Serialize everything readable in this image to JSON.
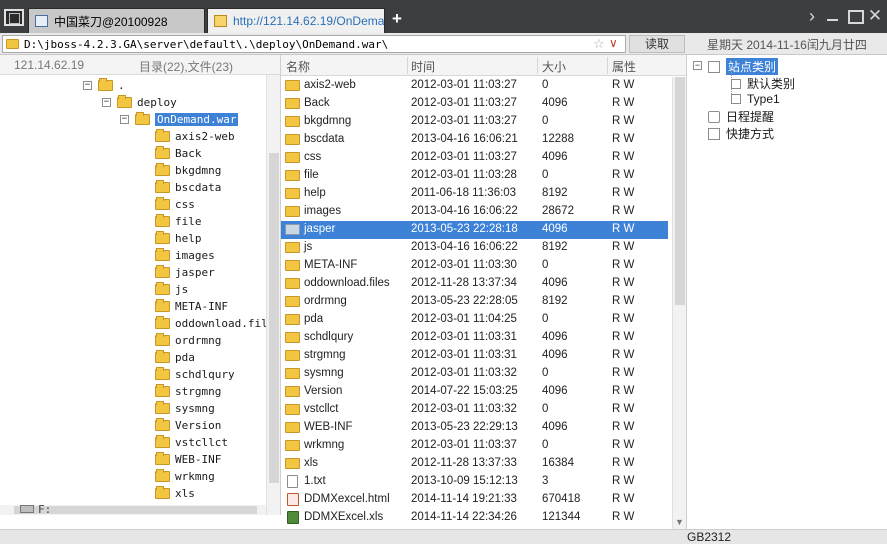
{
  "tabs": [
    {
      "label": "中国菜刀@20100928",
      "active": false
    },
    {
      "label": "http://121.14.62.19/OnDema...",
      "active": true
    }
  ],
  "new_tab_label": "+",
  "address": {
    "path": "D:\\jboss-4.2.3.GA\\server\\default\\.\\deploy\\OnDemand.war\\",
    "star_icon": "star-icon",
    "read_button": "读取",
    "date": "星期天 2014-11-16闰九月廿四"
  },
  "tree": {
    "server_ip": "121.14.62.19",
    "counts": "目录(22),文件(23)",
    "root": ".",
    "deploy": "deploy",
    "selected": "OnDemand.war",
    "children": [
      "axis2-web",
      "Back",
      "bkgdmng",
      "bscdata",
      "css",
      "file",
      "help",
      "images",
      "jasper",
      "js",
      "META-INF",
      "oddownload.file",
      "ordrmng",
      "pda",
      "schdlqury",
      "strgmng",
      "sysmng",
      "Version",
      "vstcllct",
      "WEB-INF",
      "wrkmng",
      "xls"
    ],
    "drive": "F:"
  },
  "list": {
    "headers": {
      "name": "名称",
      "time": "时间",
      "size": "大小",
      "attr": "属性"
    },
    "rows": [
      {
        "name": "axis2-web",
        "time": "2012-03-01 11:03:27",
        "size": "0",
        "attr": "R W",
        "type": "folder"
      },
      {
        "name": "Back",
        "time": "2012-03-01 11:03:27",
        "size": "4096",
        "attr": "R W",
        "type": "folder"
      },
      {
        "name": "bkgdmng",
        "time": "2012-03-01 11:03:27",
        "size": "0",
        "attr": "R W",
        "type": "folder"
      },
      {
        "name": "bscdata",
        "time": "2013-04-16 16:06:21",
        "size": "12288",
        "attr": "R W",
        "type": "folder"
      },
      {
        "name": "css",
        "time": "2012-03-01 11:03:27",
        "size": "4096",
        "attr": "R W",
        "type": "folder"
      },
      {
        "name": "file",
        "time": "2012-03-01 11:03:28",
        "size": "0",
        "attr": "R W",
        "type": "folder"
      },
      {
        "name": "help",
        "time": "2011-06-18 11:36:03",
        "size": "8192",
        "attr": "R W",
        "type": "folder"
      },
      {
        "name": "images",
        "time": "2013-04-16 16:06:22",
        "size": "28672",
        "attr": "R W",
        "type": "folder"
      },
      {
        "name": "jasper",
        "time": "2013-05-23 22:28:18",
        "size": "4096",
        "attr": "R W",
        "type": "folder",
        "selected": true
      },
      {
        "name": "js",
        "time": "2013-04-16 16:06:22",
        "size": "8192",
        "attr": "R W",
        "type": "folder"
      },
      {
        "name": "META-INF",
        "time": "2012-03-01 11:03:30",
        "size": "0",
        "attr": "R W",
        "type": "folder"
      },
      {
        "name": "oddownload.files",
        "time": "2012-11-28 13:37:34",
        "size": "4096",
        "attr": "R W",
        "type": "folder"
      },
      {
        "name": "ordrmng",
        "time": "2013-05-23 22:28:05",
        "size": "8192",
        "attr": "R W",
        "type": "folder"
      },
      {
        "name": "pda",
        "time": "2012-03-01 11:04:25",
        "size": "0",
        "attr": "R W",
        "type": "folder"
      },
      {
        "name": "schdlqury",
        "time": "2012-03-01 11:03:31",
        "size": "4096",
        "attr": "R W",
        "type": "folder"
      },
      {
        "name": "strgmng",
        "time": "2012-03-01 11:03:31",
        "size": "4096",
        "attr": "R W",
        "type": "folder"
      },
      {
        "name": "sysmng",
        "time": "2012-03-01 11:03:32",
        "size": "0",
        "attr": "R W",
        "type": "folder"
      },
      {
        "name": "Version",
        "time": "2014-07-22 15:03:25",
        "size": "4096",
        "attr": "R W",
        "type": "folder"
      },
      {
        "name": "vstcllct",
        "time": "2012-03-01 11:03:32",
        "size": "0",
        "attr": "R W",
        "type": "folder"
      },
      {
        "name": "WEB-INF",
        "time": "2013-05-23 22:29:13",
        "size": "4096",
        "attr": "R W",
        "type": "folder"
      },
      {
        "name": "wrkmng",
        "time": "2012-03-01 11:03:37",
        "size": "0",
        "attr": "R W",
        "type": "folder"
      },
      {
        "name": "xls",
        "time": "2012-11-28 13:37:33",
        "size": "16384",
        "attr": "R W",
        "type": "folder"
      },
      {
        "name": "1.txt",
        "time": "2013-10-09 15:12:13",
        "size": "3",
        "attr": "R W",
        "type": "txt"
      },
      {
        "name": "DDMXexcel.html",
        "time": "2014-11-14 19:21:33",
        "size": "670418",
        "attr": "R W",
        "type": "html"
      },
      {
        "name": "DDMXExcel.xls",
        "time": "2014-11-14 22:34:26",
        "size": "121344",
        "attr": "R W",
        "type": "xls"
      }
    ]
  },
  "side": {
    "site_category": "站点类别",
    "default_category": "默认类别",
    "type1": "Type1",
    "schedule": "日程提醒",
    "shortcut": "快捷方式"
  },
  "status": {
    "encoding": "GB2312"
  },
  "colors": {
    "selection": "#3e82d8",
    "folder": "#f3c642",
    "titlebar": "#3c3f41"
  }
}
